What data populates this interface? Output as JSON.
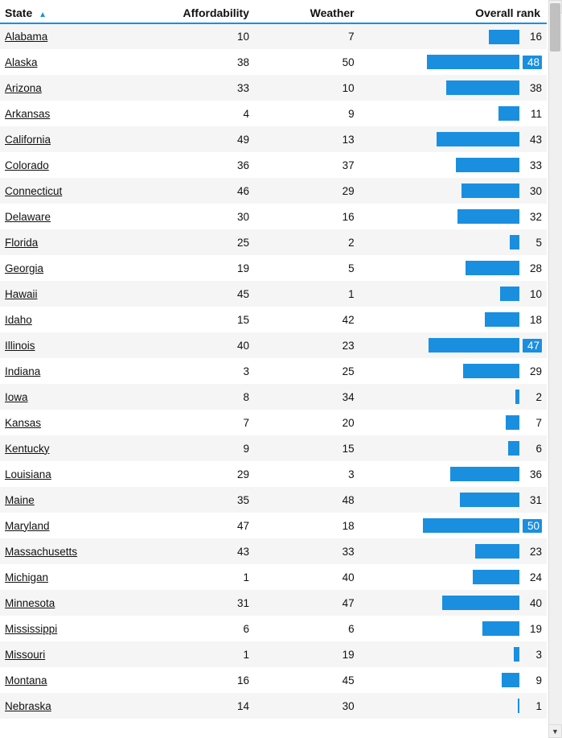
{
  "header": {
    "col_state": "State",
    "col_affordability": "Affordability",
    "col_weather": "Weather",
    "col_overall": "Overall rank",
    "sort_indicator": "▲"
  },
  "rows": [
    {
      "state": "Alabama",
      "affordability": 10,
      "weather": 7,
      "rank": 16,
      "highlight": false
    },
    {
      "state": "Alaska",
      "affordability": 38,
      "weather": 50,
      "rank": 48,
      "highlight": true
    },
    {
      "state": "Arizona",
      "affordability": 33,
      "weather": 10,
      "rank": 38,
      "highlight": false
    },
    {
      "state": "Arkansas",
      "affordability": 4,
      "weather": 9,
      "rank": 11,
      "highlight": false
    },
    {
      "state": "California",
      "affordability": 49,
      "weather": 13,
      "rank": 43,
      "highlight": false
    },
    {
      "state": "Colorado",
      "affordability": 36,
      "weather": 37,
      "rank": 33,
      "highlight": false
    },
    {
      "state": "Connecticut",
      "affordability": 46,
      "weather": 29,
      "rank": 30,
      "highlight": false
    },
    {
      "state": "Delaware",
      "affordability": 30,
      "weather": 16,
      "rank": 32,
      "highlight": false
    },
    {
      "state": "Florida",
      "affordability": 25,
      "weather": 2,
      "rank": 5,
      "highlight": false
    },
    {
      "state": "Georgia",
      "affordability": 19,
      "weather": 5,
      "rank": 28,
      "highlight": false
    },
    {
      "state": "Hawaii",
      "affordability": 45,
      "weather": 1,
      "rank": 10,
      "highlight": false
    },
    {
      "state": "Idaho",
      "affordability": 15,
      "weather": 42,
      "rank": 18,
      "highlight": false
    },
    {
      "state": "Illinois",
      "affordability": 40,
      "weather": 23,
      "rank": 47,
      "highlight": true
    },
    {
      "state": "Indiana",
      "affordability": 3,
      "weather": 25,
      "rank": 29,
      "highlight": false
    },
    {
      "state": "Iowa",
      "affordability": 8,
      "weather": 34,
      "rank": 2,
      "highlight": false
    },
    {
      "state": "Kansas",
      "affordability": 7,
      "weather": 20,
      "rank": 7,
      "highlight": false
    },
    {
      "state": "Kentucky",
      "affordability": 9,
      "weather": 15,
      "rank": 6,
      "highlight": false
    },
    {
      "state": "Louisiana",
      "affordability": 29,
      "weather": 3,
      "rank": 36,
      "highlight": false
    },
    {
      "state": "Maine",
      "affordability": 35,
      "weather": 48,
      "rank": 31,
      "highlight": false
    },
    {
      "state": "Maryland",
      "affordability": 47,
      "weather": 18,
      "rank": 50,
      "highlight": true
    },
    {
      "state": "Massachusetts",
      "affordability": 43,
      "weather": 33,
      "rank": 23,
      "highlight": false
    },
    {
      "state": "Michigan",
      "affordability": 1,
      "weather": 40,
      "rank": 24,
      "highlight": false
    },
    {
      "state": "Minnesota",
      "affordability": 31,
      "weather": 47,
      "rank": 40,
      "highlight": false
    },
    {
      "state": "Mississippi",
      "affordability": 6,
      "weather": 6,
      "rank": 19,
      "highlight": false
    },
    {
      "state": "Missouri",
      "affordability": 1,
      "weather": 19,
      "rank": 3,
      "highlight": false
    },
    {
      "state": "Montana",
      "affordability": 16,
      "weather": 45,
      "rank": 9,
      "highlight": false
    },
    {
      "state": "Nebraska",
      "affordability": 14,
      "weather": 30,
      "rank": 1,
      "highlight": false
    }
  ],
  "max_rank": 50,
  "bar_scale": 120
}
